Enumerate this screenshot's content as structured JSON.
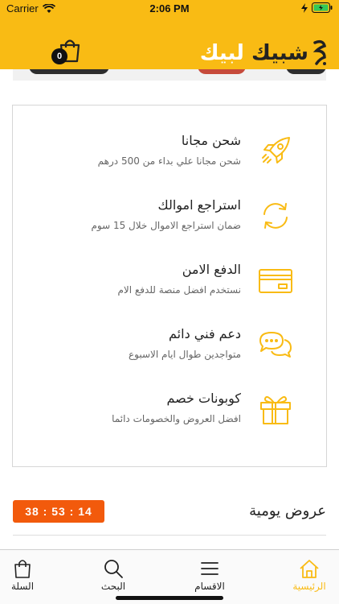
{
  "status_bar": {
    "carrier": "Carrier",
    "time": "2:06 PM"
  },
  "header": {
    "cart_count": "0",
    "logo_word_1": "شبيك",
    "logo_word_2": "لبيك"
  },
  "features": [
    {
      "title": "شحن مجانا",
      "subtitle": "شحن مجانا علي بداء من 500 درهم",
      "icon": "rocket-icon"
    },
    {
      "title": "استراجع اموالك",
      "subtitle": "ضمان استراجع الاموال خلال 15 سوم",
      "icon": "refresh-icon"
    },
    {
      "title": "الدفع الامن",
      "subtitle": "نستخدم افضل منصة للدفع الام",
      "icon": "credit-card-icon"
    },
    {
      "title": "دعم فني دائم",
      "subtitle": "متواجدين طوال ايام الاسبوع",
      "icon": "chat-bubbles-icon"
    },
    {
      "title": "كوبونات خصم",
      "subtitle": "افضل العروض والخصومات دائما",
      "icon": "gift-icon"
    }
  ],
  "deals": {
    "title": "عروض يومية",
    "timer": "38 : 53 : 14"
  },
  "tabs": {
    "cart": "السلة",
    "search": "البحث",
    "categories": "الاقسام",
    "home": "الرئيسية"
  },
  "colors": {
    "brand": "#f9bb14",
    "timer": "#f25a0c"
  }
}
